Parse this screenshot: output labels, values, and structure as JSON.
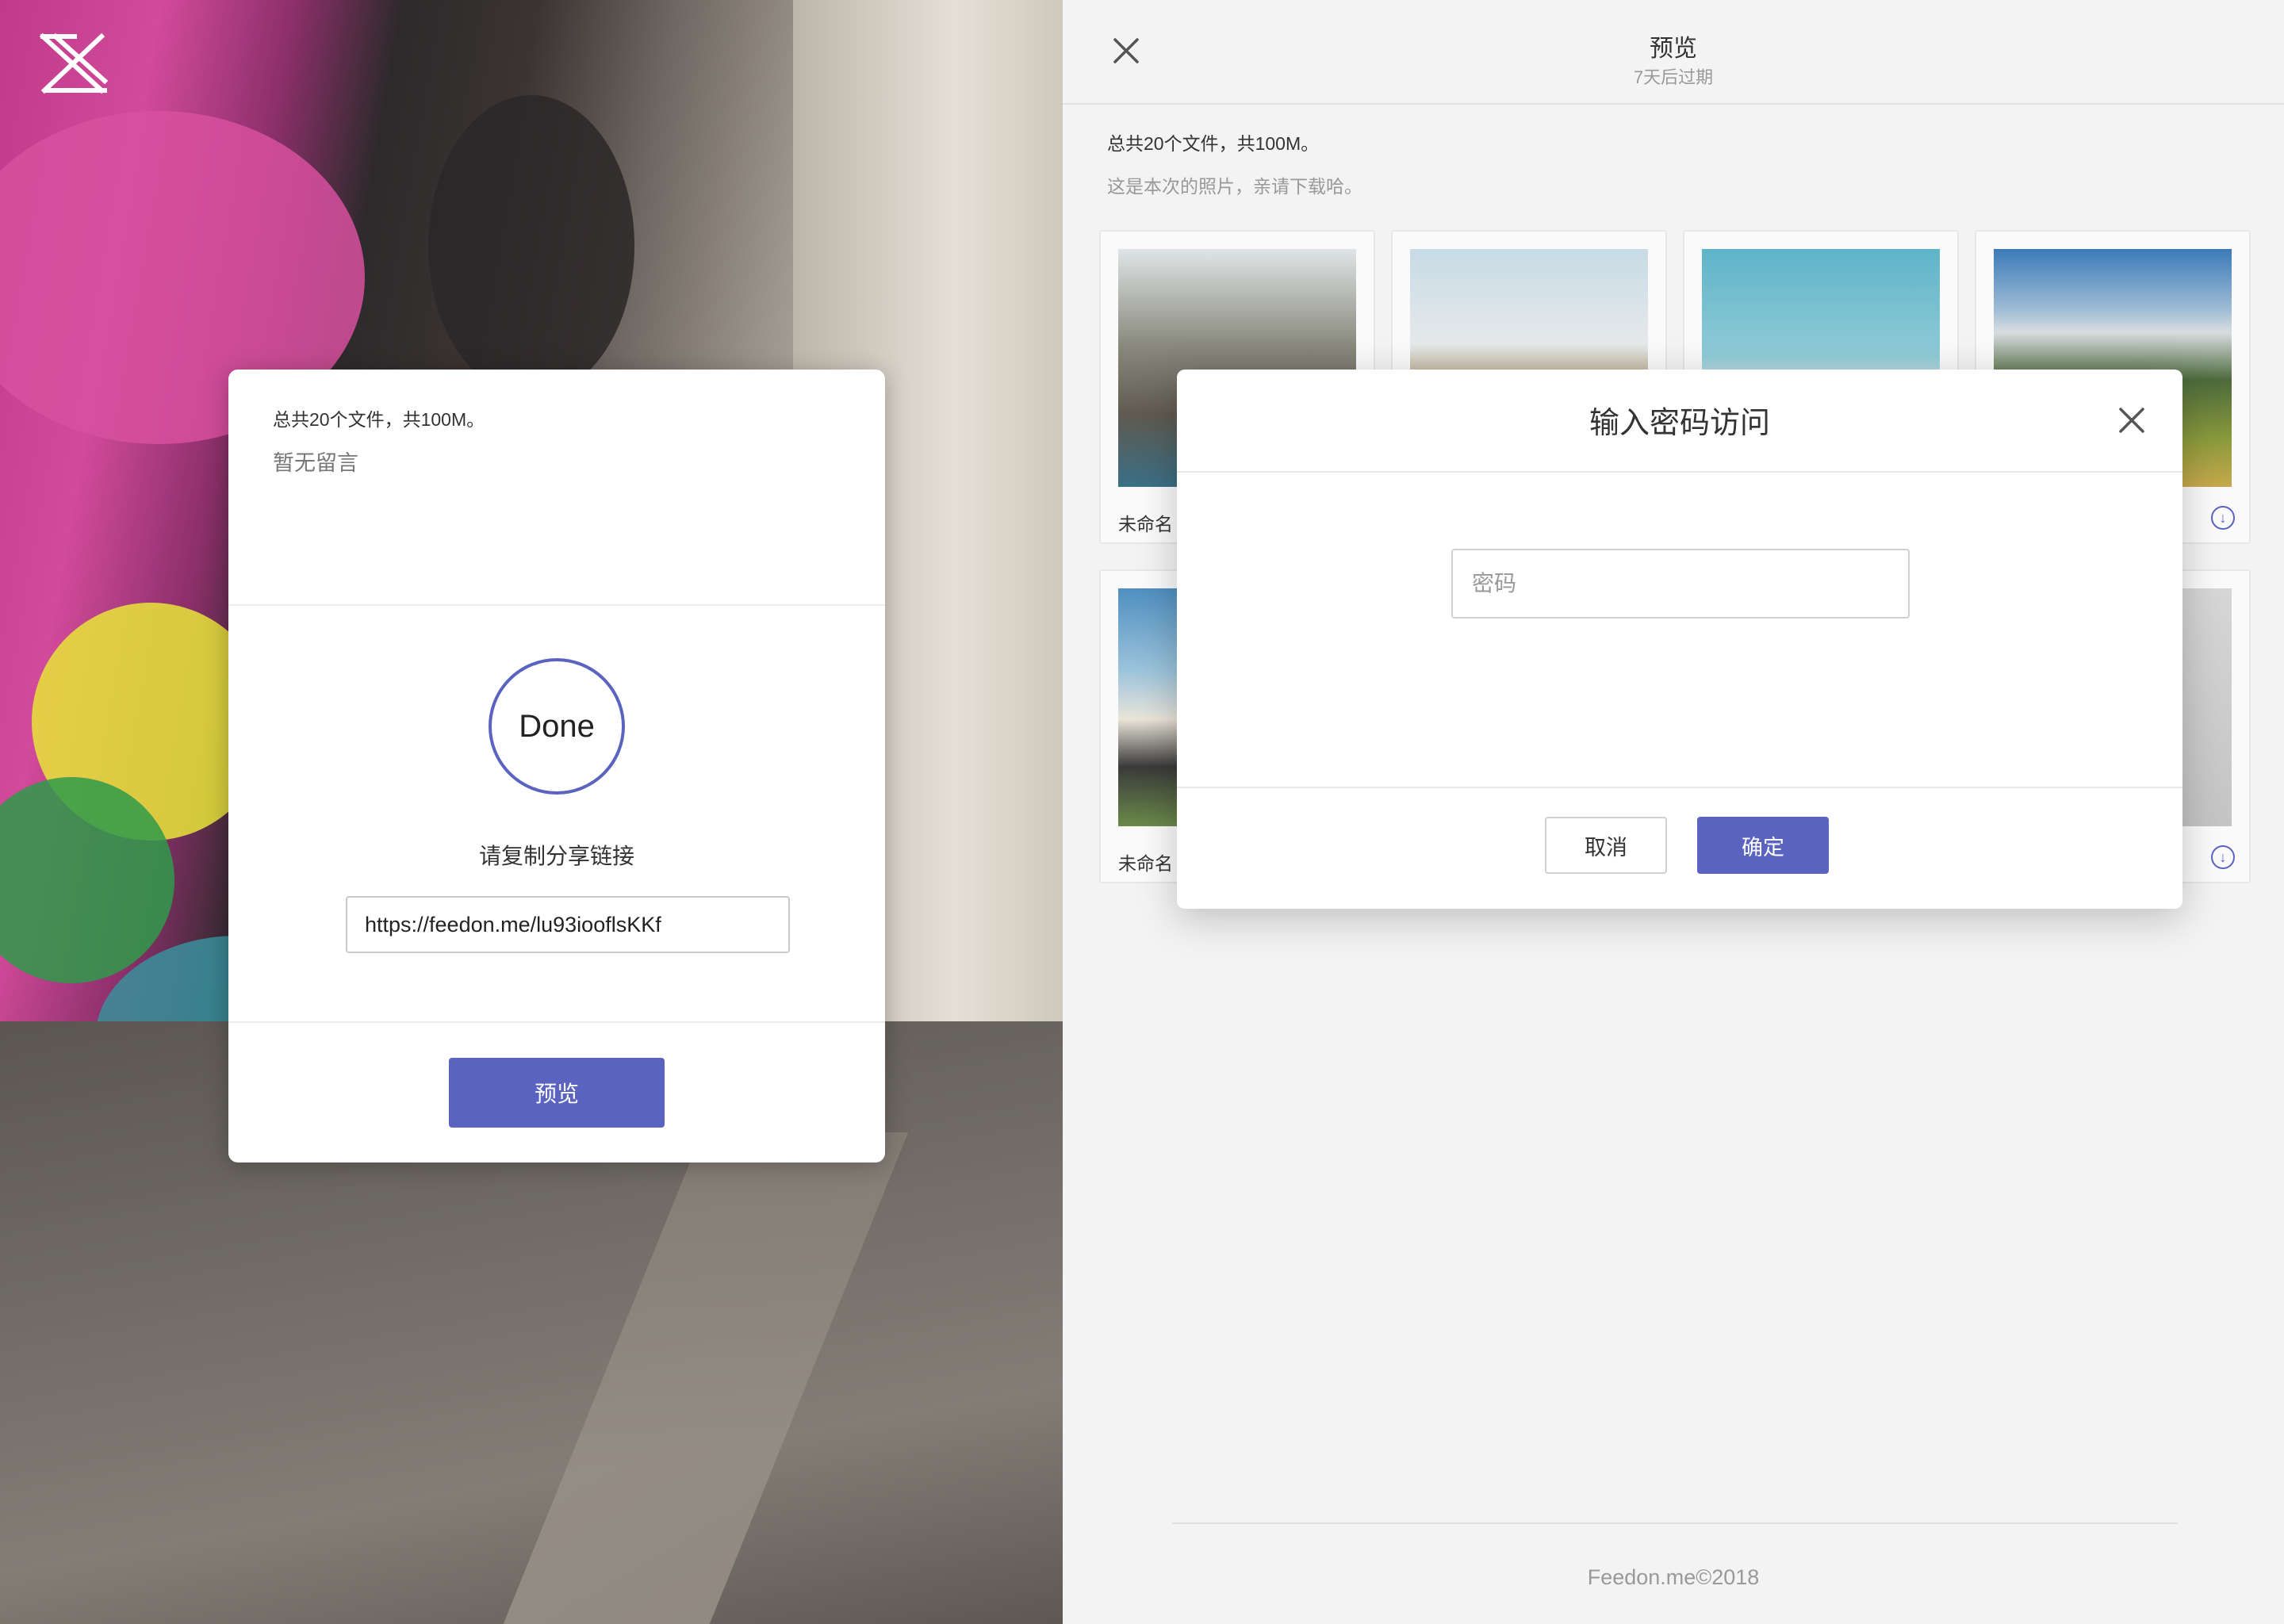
{
  "logo": {
    "icon": "x-logo-icon"
  },
  "share_card": {
    "summary": "总共20个文件，共100M。",
    "note": "暂无留言",
    "status": "Done",
    "copy_label": "请复制分享链接",
    "link": "https://feedon.me/lu93iooflsKKf",
    "preview_button": "预览"
  },
  "preview_panel": {
    "title": "预览",
    "subtitle": "7天后过期",
    "summary": "总共20个文件，共100M。",
    "description": "这是本次的照片，亲请下载哈。",
    "files": [
      {
        "name": "未命名"
      },
      {
        "name": ""
      },
      {
        "name": ""
      },
      {
        "name": ""
      },
      {
        "name": "未命名"
      },
      {
        "name": ""
      },
      {
        "name": ""
      },
      {
        "name": ""
      }
    ],
    "footer": "Feedon.me©2018"
  },
  "password_modal": {
    "title": "输入密码访问",
    "placeholder": "密码",
    "cancel": "取消",
    "confirm": "确定"
  },
  "colors": {
    "accent": "#5b63c0"
  }
}
